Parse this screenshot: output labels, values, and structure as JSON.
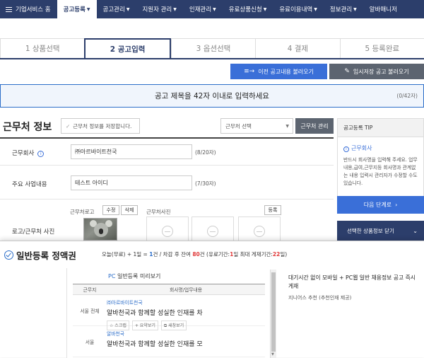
{
  "nav": {
    "items": [
      {
        "label": "기업서비스 홈"
      },
      {
        "label": "공고등록"
      },
      {
        "label": "공고관리"
      },
      {
        "label": "지원자 관리"
      },
      {
        "label": "인재관리"
      },
      {
        "label": "유료상품신청"
      },
      {
        "label": "유료이용내역"
      },
      {
        "label": "정보관리"
      },
      {
        "label": "알바매니저"
      }
    ]
  },
  "steps": [
    {
      "label": "1 상품선택"
    },
    {
      "label": "2 공고입력"
    },
    {
      "label": "3 옵션선택"
    },
    {
      "label": "4 결제"
    },
    {
      "label": "5 등록완료"
    }
  ],
  "actions": {
    "load_previous": "이전 공고내용 불러오기",
    "load_temp": "임시저장 공고 불러오기"
  },
  "title_input": {
    "placeholder": "공고 제목을 42자 이내로 입력하세요",
    "count": "(0/42자)"
  },
  "section": {
    "title": "근무처 정보",
    "save_check": "근무처 정보를 저장합니다.",
    "select_label": "근무처 선택",
    "manage_button": "근무처 관리"
  },
  "form": {
    "company_label": "근무회사",
    "company_value": "㈜아르바이트천국",
    "company_count": "(8/20자)",
    "business_label": "주요 사업내용",
    "business_value": "테스트 아이디",
    "business_count": "(7/30자)",
    "logo_label": "로고/근무처 사진",
    "logo_sub": "근무처로고",
    "modify": "수정",
    "delete": "삭제",
    "photo_sub": "근무처사진",
    "register": "등록"
  },
  "tip": {
    "header": "공고등록 TIP",
    "sub": "근무회사",
    "body": "반드시 회사명을 입력해 주세요. 업무내용,급여,근무지등 회사명과 관계없는 내용 입력시 관리자가 수정할 수도 있습니다."
  },
  "next_step": "다음 단계로",
  "close_product": "선택한 상품정보 닫기",
  "overlay": {
    "title": "일반등록 정액권",
    "desc_prefix": "오늘(무료) + 1일 = ",
    "desc_one": "1",
    "desc_mid": "건 / 차감 후 잔여 ",
    "desc_remain": "80",
    "desc_mid2": "건 (유료기간:",
    "desc_days": "1",
    "desc_mid3": "일 최대 게재기간:",
    "desc_max": "22",
    "desc_suffix": "일)",
    "preview_pc": "PC",
    "preview_title": " 일반등록 미리보기",
    "col_region": "근무지",
    "col_company": "회사명/업무내용",
    "rows": [
      {
        "region": "서울 전체",
        "corp": "㈜아르바이트천국",
        "job": "알바천국과 함께할 성실한 인재를 차",
        "act1": "스크랩",
        "act2": "요약보기",
        "act3": "새창보기"
      },
      {
        "region": "서울",
        "corp": "알바천국",
        "job": "알바천국과 함께할 성실한 인재를 모",
        "act1": "",
        "act2": "",
        "act3": ""
      }
    ],
    "right_main": "대기시간 없이 모바일 + PC웹 일반 채용정보 공고 즉시 게재",
    "right_sub": "지니어스 추천 (추천인재 제공)"
  }
}
